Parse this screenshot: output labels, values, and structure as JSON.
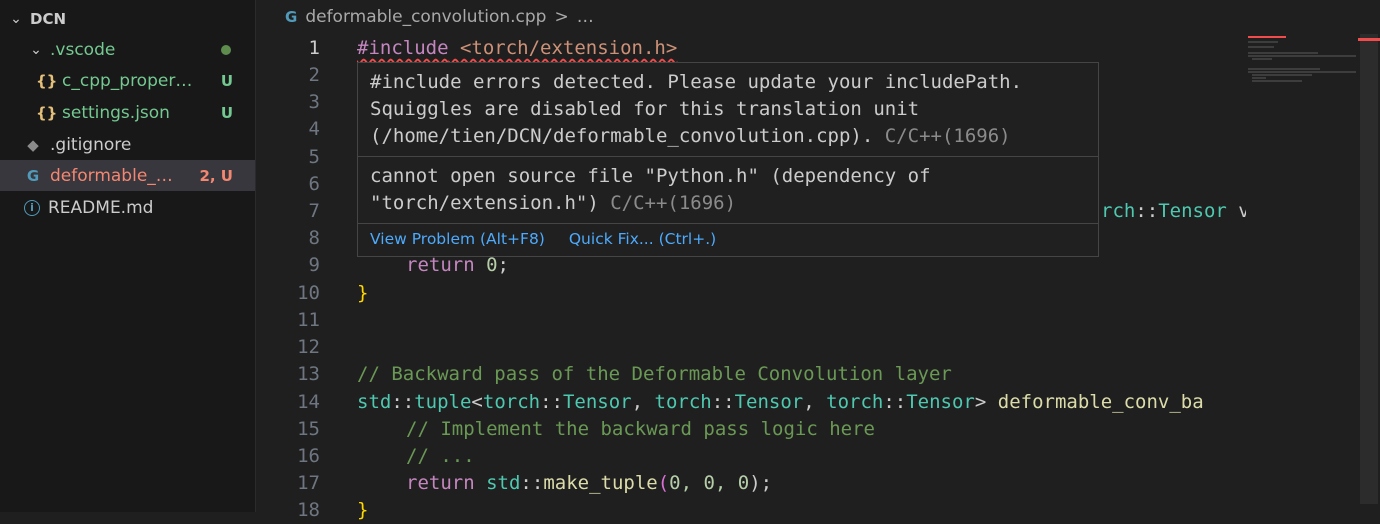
{
  "explorer": {
    "root": "DCN",
    "items": [
      {
        "label": ".vscode",
        "badge": ""
      },
      {
        "label": "c_cpp_properti…",
        "badge": "U",
        "icon_text": "{}"
      },
      {
        "label": "settings.json",
        "badge": "U",
        "icon_text": "{}"
      },
      {
        "label": ".gitignore",
        "badge": ""
      },
      {
        "label": "deformable_c…",
        "badge": "2, U",
        "icon_text": "G"
      },
      {
        "label": "README.md",
        "badge": "",
        "icon_text": "i"
      }
    ]
  },
  "breadcrumb": {
    "file": "deformable_convolution.cpp",
    "sep": ">",
    "more": "…"
  },
  "editor": {
    "line_numbers": [
      "1",
      "2",
      "3",
      "4",
      "5",
      "6",
      "7",
      "8",
      "9",
      "10",
      "11",
      "12",
      "13",
      "14",
      "15",
      "16",
      "17",
      "18"
    ],
    "line1": {
      "kw": "#include",
      "rest": " <torch/extension.h>"
    },
    "line7_tail": {
      "a": "rch",
      "b": "::",
      "c": "Tensor",
      "d": " v"
    },
    "line9": {
      "kw": "return",
      "num": "0",
      "end": ";"
    },
    "line10": "}",
    "line13": "// Backward pass of the Deformable Convolution layer",
    "line14": {
      "std": "std",
      "tuple": "tuple",
      "t1": "torch",
      "T1": "Tensor",
      "t2": "torch",
      "T2": "Tensor",
      "t3": "torch",
      "T3": "Tensor",
      "fn": "deformable_conv_ba"
    },
    "line15": "// Implement the backward pass logic here",
    "line16": "// ...",
    "line17": {
      "kw": "return",
      "std": "std",
      "fn": "make_tuple",
      "args": "0, 0, 0",
      "end": ");"
    },
    "line18": "}"
  },
  "hover": {
    "msg1_line1": "#include errors detected. Please update your includePath.",
    "msg1_line2": "Squiggles are disabled for this translation unit",
    "msg1_line3": "(/home/tien/DCN/deformable_convolution.cpp).",
    "msg1_src": "C/C++(1696)",
    "msg2_line1": "cannot open source file \"Python.h\" (dependency of",
    "msg2_line2": "\"torch/extension.h\")",
    "msg2_src": "C/C++(1696)",
    "view_problem": "View Problem (Alt+F8)",
    "quick_fix": "Quick Fix... (Ctrl+.)"
  },
  "colors": {
    "accent": "#4daafc",
    "error": "#f14c4c",
    "untracked": "#73c991",
    "modified": "#f48771"
  }
}
